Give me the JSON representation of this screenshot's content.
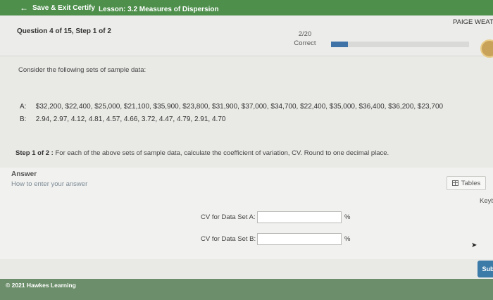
{
  "topbar": {
    "exit_label": "Save & Exit Certify",
    "lesson": "Lesson: 3.2 Measures of Dispersion"
  },
  "header": {
    "question": "Question 4 of 15, Step 1 of 2",
    "score": "2/20",
    "score_status": "Correct",
    "progress_fraction": 0.12,
    "user": "PAIGE WEATH"
  },
  "problem": {
    "intro": "Consider the following sets of sample data:",
    "sets": [
      {
        "label": "A:",
        "values": "$32,200, $22,400, $25,000, $21,100, $35,900, $23,800, $31,900, $37,000, $34,700, $22,400, $35,000, $36,400, $36,200, $23,700"
      },
      {
        "label": "B:",
        "values": "2.94, 2.97, 4.12, 4.81, 4.57, 4.66, 3.72, 4.47, 4.79, 2.91, 4.70"
      }
    ],
    "step_label": "Step 1 of 2 :",
    "step_text": "For each of the above sets of sample data, calculate the coefficient of variation, CV. Round to one decimal place."
  },
  "answer": {
    "title": "Answer",
    "how_to": "How to enter your answer",
    "tables_label": "Tables",
    "keypad_label": "Keyb",
    "cv_a_label": "CV for Data Set A:",
    "cv_a_value": "",
    "cv_b_label": "CV for Data Set B:",
    "cv_b_value": "",
    "unit": "%"
  },
  "submit_label": "Sub",
  "footer": {
    "copyright": "© 2021 Hawkes Learning"
  }
}
